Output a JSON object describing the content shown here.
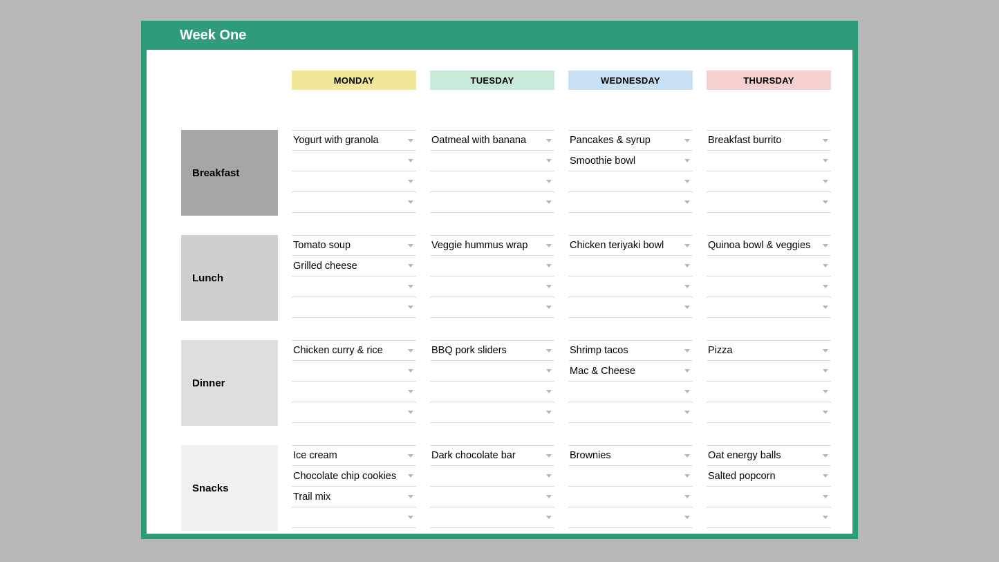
{
  "title": "Week One",
  "days": [
    "MONDAY",
    "TUESDAY",
    "WEDNESDAY",
    "THURSDAY"
  ],
  "meals": [
    "Breakfast",
    "Lunch",
    "Dinner",
    "Snacks"
  ],
  "cells": {
    "breakfast": {
      "mon": [
        "Yogurt with granola",
        "",
        "",
        ""
      ],
      "tue": [
        "Oatmeal with banana",
        "",
        "",
        ""
      ],
      "wed": [
        "Pancakes & syrup",
        "Smoothie bowl",
        "",
        ""
      ],
      "thu": [
        "Breakfast burrito",
        "",
        "",
        ""
      ]
    },
    "lunch": {
      "mon": [
        "Tomato soup",
        "Grilled cheese",
        "",
        ""
      ],
      "tue": [
        "Veggie hummus wrap",
        "",
        "",
        ""
      ],
      "wed": [
        "Chicken teriyaki bowl",
        "",
        "",
        ""
      ],
      "thu": [
        "Quinoa bowl & veggies",
        "",
        "",
        ""
      ]
    },
    "dinner": {
      "mon": [
        "Chicken curry & rice",
        "",
        "",
        ""
      ],
      "tue": [
        "BBQ pork sliders",
        "",
        "",
        ""
      ],
      "wed": [
        "Shrimp tacos",
        "Mac & Cheese",
        "",
        ""
      ],
      "thu": [
        "Pizza",
        "",
        "",
        ""
      ]
    },
    "snacks": {
      "mon": [
        "Ice cream",
        "Chocolate chip cookies",
        "Trail mix",
        ""
      ],
      "tue": [
        "Dark chocolate bar",
        "",
        "",
        ""
      ],
      "wed": [
        "Brownies",
        "",
        "",
        ""
      ],
      "thu": [
        "Oat energy balls",
        "Salted popcorn",
        "",
        ""
      ]
    }
  }
}
